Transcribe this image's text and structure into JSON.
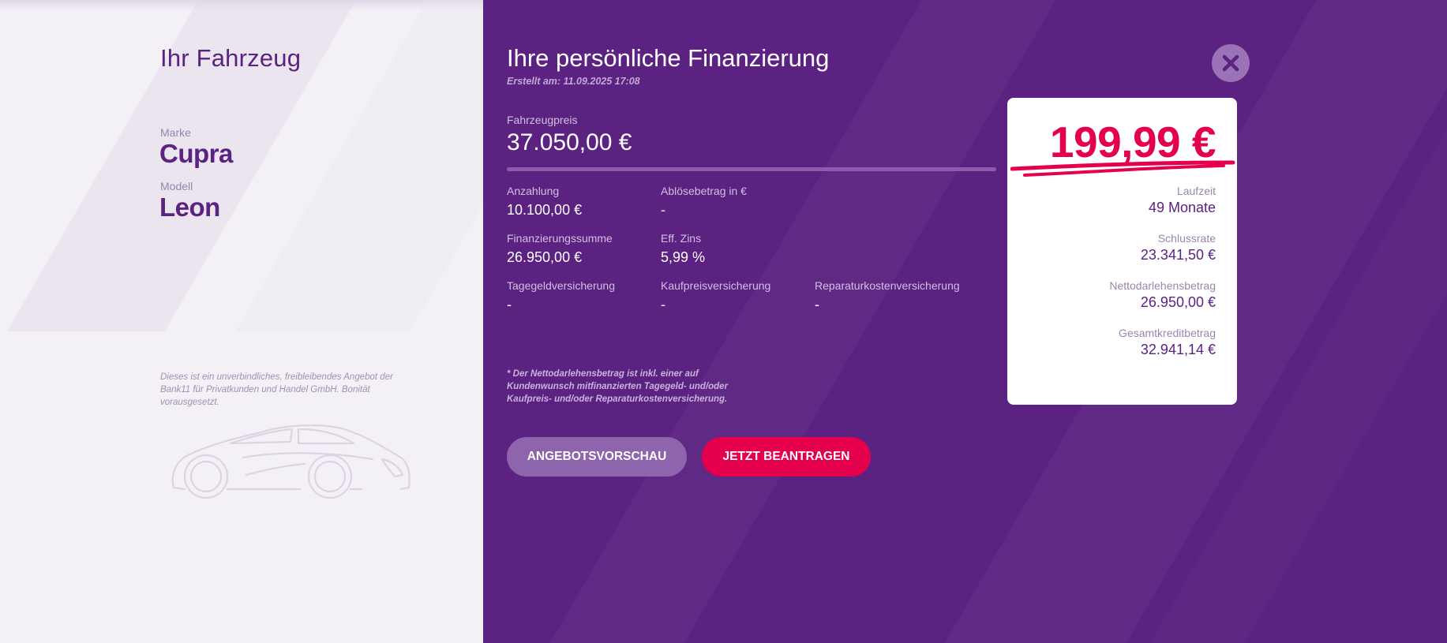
{
  "vehicle": {
    "title": "Ihr Fahrzeug",
    "brand_label": "Marke",
    "brand": "Cupra",
    "model_label": "Modell",
    "model": "Leon",
    "disclaimer": "Dieses ist ein unverbindliches, freibleibendes Angebot der Bank11 für Privatkunden und Handel GmbH. Bonität vorausgesetzt."
  },
  "financing": {
    "title": "Ihre persönliche Finanzierung",
    "created": "Erstellt am: 11.09.2025 17:08",
    "price_label": "Fahrzeugpreis",
    "price_value": "37.050,00 €",
    "details": [
      {
        "label": "Anzahlung",
        "value": "10.100,00 €"
      },
      {
        "label": "Ablösebetrag in €",
        "value": "-"
      },
      {
        "label": "Finanzierungssumme",
        "value": "26.950,00 €"
      },
      {
        "label": "Eff. Zins",
        "value": "5,99 %"
      },
      {
        "label": "Tagegeldversicherung",
        "value": "-"
      },
      {
        "label": "Kaufpreisversicherung",
        "value": "-"
      },
      {
        "label": "Reparaturkostenversicherung",
        "value": "-"
      }
    ],
    "disclaimer": "* Der Nettodarlehensbetrag ist inkl. einer auf Kundenwunsch mitfinanzierten Tagegeld- und/oder Kaufpreis- und/oder Reparaturkostenversicherung.",
    "buttons": {
      "preview": "ANGEBOTSVORSCHAU",
      "apply": "JETZT BEANTRAGEN"
    }
  },
  "summary": {
    "rate": "199,99 €",
    "rows": [
      {
        "label": "Laufzeit",
        "value": "49 Monate"
      },
      {
        "label": "Schlussrate",
        "value": "23.341,50 €"
      },
      {
        "label": "Nettodarlehensbetrag",
        "value": "26.950,00 €"
      },
      {
        "label": "Gesamtkreditbetrag",
        "value": "32.941,14 €"
      }
    ]
  },
  "icons": {
    "close": "close-icon",
    "car": "car-outline-icon"
  },
  "colors": {
    "brand_purple": "#5b2282",
    "accent_pink": "#e5004d",
    "left_background": "#f4f1f6",
    "card_background": "#ffffff",
    "secondary_button": "#8e64ac"
  }
}
